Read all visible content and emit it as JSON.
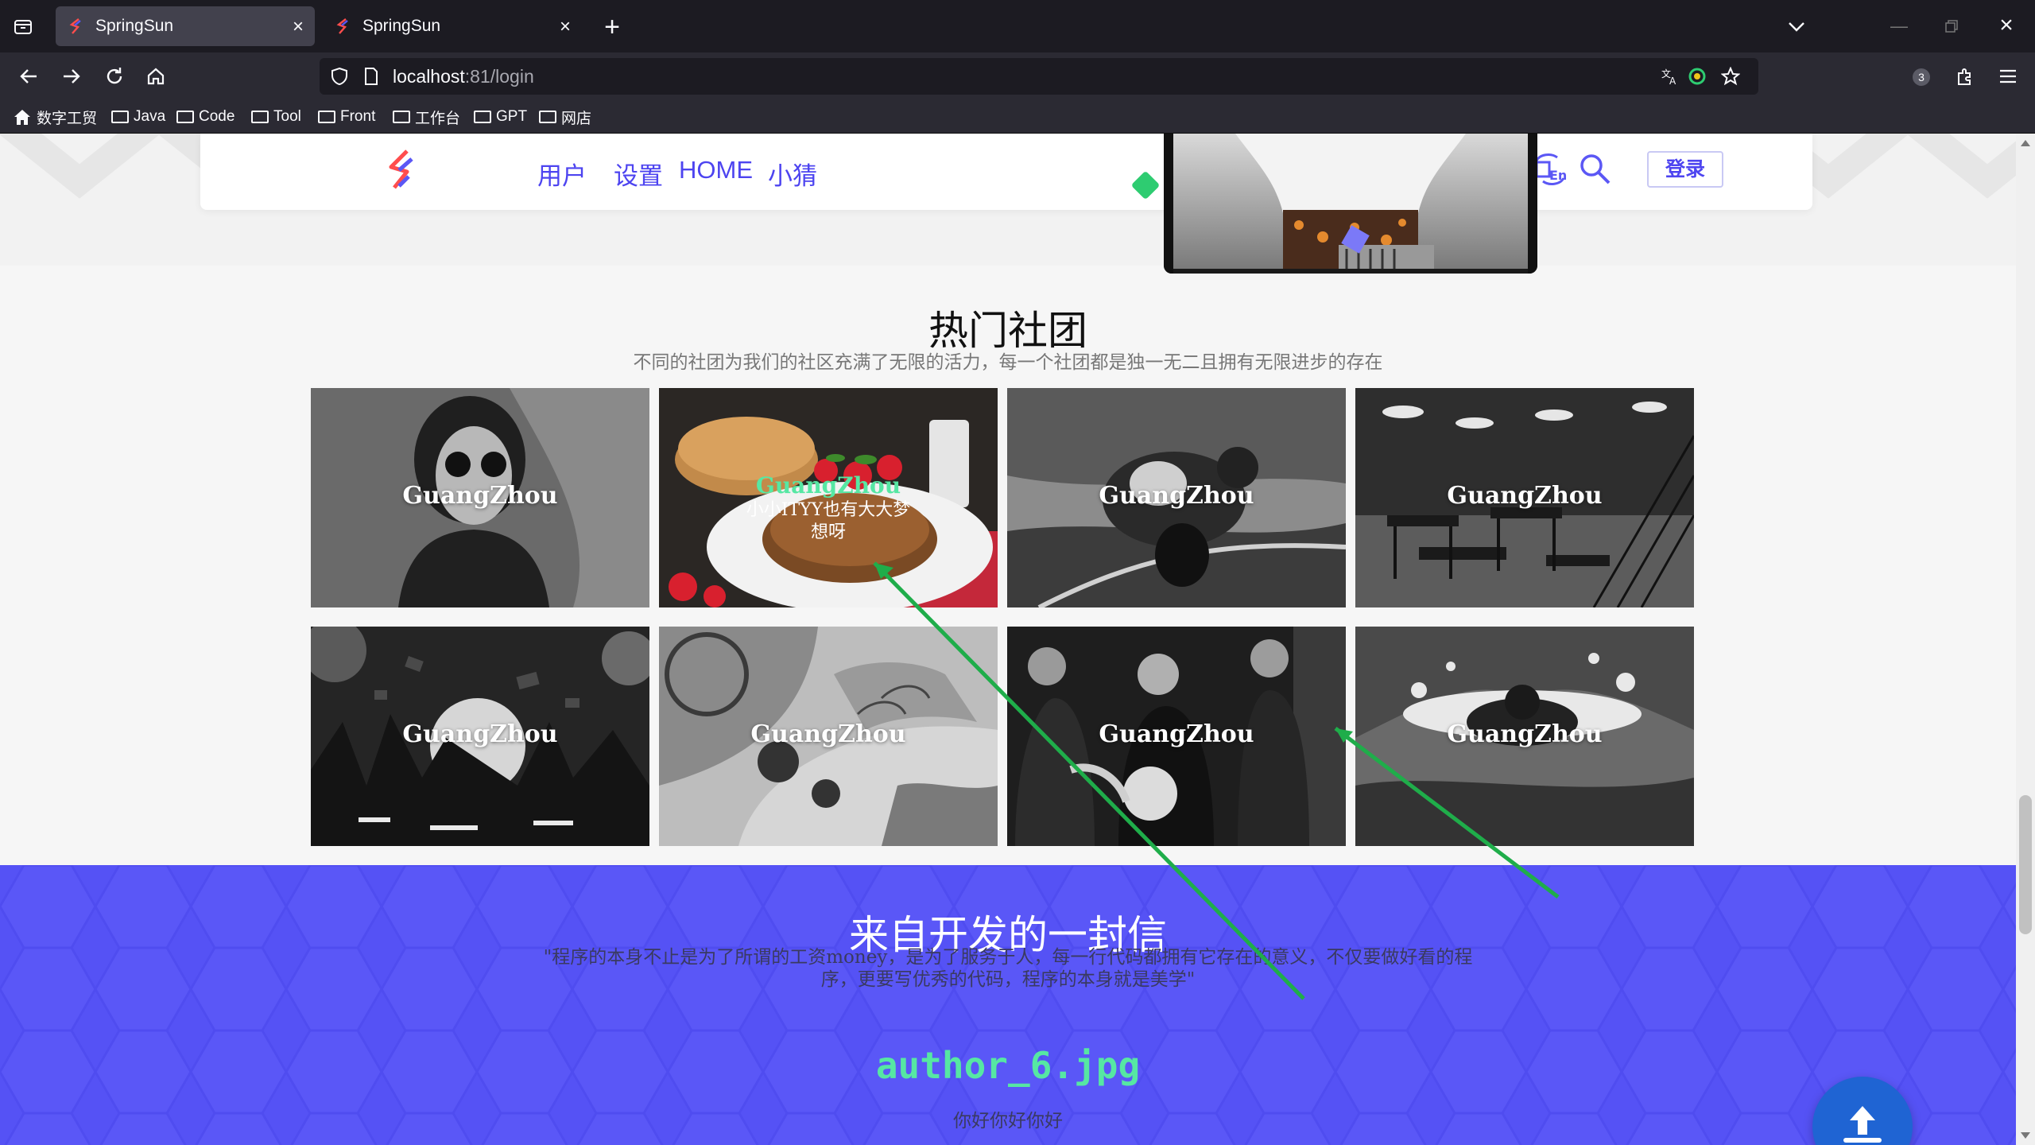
{
  "browser": {
    "tabs": [
      {
        "title": "SpringSun",
        "active": true
      },
      {
        "title": "SpringSun",
        "active": false
      }
    ],
    "url_host": "localhost",
    "url_rest": ":81/login",
    "extension_badge": "3",
    "bookmarks": [
      {
        "label": "数字工贸",
        "icon": "home-icon"
      },
      {
        "label": "Java",
        "icon": "folder-icon"
      },
      {
        "label": "Code",
        "icon": "folder-icon"
      },
      {
        "label": "Tool",
        "icon": "folder-icon"
      },
      {
        "label": "Front",
        "icon": "folder-icon"
      },
      {
        "label": "工作台",
        "icon": "folder-icon"
      },
      {
        "label": "GPT",
        "icon": "folder-icon"
      },
      {
        "label": "网店",
        "icon": "folder-icon"
      }
    ]
  },
  "header": {
    "nav": [
      "用户",
      "设置",
      "HOME",
      "小猜"
    ],
    "login_label": "登录",
    "social_icons": [
      "qq-icon",
      "wechat-icon",
      "facebook-icon",
      "twitter-icon",
      "logo-icon",
      "language-icon",
      "search-icon"
    ]
  },
  "clubs": {
    "title": "热门社团",
    "subtitle": "不同的社团为我们的社区充满了无限的活力，每一个社团都是独一无二且拥有无限进步的存在",
    "tiles": [
      {
        "label": "GuangZhou"
      },
      {
        "label": "GuangZhou",
        "hover_text": "小小ITYY也有大大梦想呀"
      },
      {
        "label": "GuangZhou"
      },
      {
        "label": "GuangZhou"
      },
      {
        "label": "GuangZhou"
      },
      {
        "label": "GuangZhou"
      },
      {
        "label": "GuangZhou"
      },
      {
        "label": "GuangZhou"
      }
    ]
  },
  "letter": {
    "title": "来自开发的一封信",
    "body": "\"程序的本身不止是为了所谓的工资money，是为了服务于人，每一行代码都拥有它存在的意义，不仅要做好看的程序，更要写优秀的代码，程序的本身就是美学\"",
    "author_image": "author_6.jpg",
    "author_name": "你好你好你好"
  },
  "colors": {
    "accent": "#4d44f0",
    "letter_bg": "#5552f5",
    "backtop": "#1f64d3",
    "author_alt": "#56e7a3"
  }
}
